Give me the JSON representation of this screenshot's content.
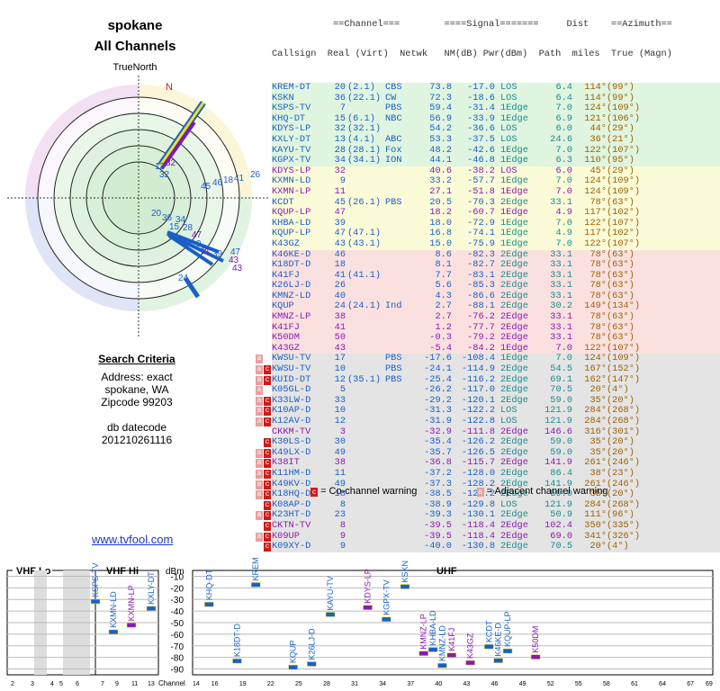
{
  "header": {
    "title": "spokane",
    "subtitle": "All Channels"
  },
  "polar": {
    "north_label": "TrueNorth",
    "n_mark": "N"
  },
  "criteria": {
    "heading": "Search Criteria",
    "address": "Address: exact",
    "city": "spokane, WA",
    "zip": "Zipcode 99203",
    "db": "db datecode",
    "db_value": "201210261116"
  },
  "link": "www.tvfool.com",
  "table": {
    "head1": "           ==Channel===        ====Signal=======     Dist    ==Azimuth==",
    "head2": "Callsign  Real (Virt)  Netwk   NM(dB) Pwr(dBm)  Path  miles  True (Magn)",
    "colors": {
      "green": "#dff5df",
      "yellow": "#fbfbd8",
      "red": "#fbe0e0",
      "gray": "#e4e4e4",
      "blue": "#1a5fc8",
      "purple": "#8a1ab0",
      "teal": "#1a8c8c",
      "olive": "#a06000",
      "darkred": "#c01010"
    },
    "rows": [
      {
        "call": "KREM-DT",
        "real": "20",
        "virt": "(2.1)",
        "net": "CBS",
        "nm": "73.8",
        "pwr": "-17.0",
        "path": "LOS",
        "dist": "6.4",
        "tru": "114°",
        "mag": "(99°)",
        "bg": "green",
        "c": "blue",
        "flag": ""
      },
      {
        "call": "KSKN",
        "real": "36",
        "virt": "(22.1)",
        "net": "CW",
        "nm": "72.3",
        "pwr": "-18.6",
        "path": "LOS",
        "dist": "6.4",
        "tru": "114°",
        "mag": "(99°)",
        "bg": "green",
        "c": "blue",
        "flag": ""
      },
      {
        "call": "KSPS-TV",
        "real": "7",
        "virt": "",
        "net": "PBS",
        "nm": "59.4",
        "pwr": "-31.4",
        "path": "1Edge",
        "dist": "7.0",
        "tru": "124°",
        "mag": "(109°)",
        "bg": "green",
        "c": "blue",
        "flag": ""
      },
      {
        "call": "KHQ-DT",
        "real": "15",
        "virt": "(6.1)",
        "net": "NBC",
        "nm": "56.9",
        "pwr": "-33.9",
        "path": "1Edge",
        "dist": "6.9",
        "tru": "121°",
        "mag": "(106°)",
        "bg": "green",
        "c": "blue",
        "flag": ""
      },
      {
        "call": "KDYS-LP",
        "real": "32",
        "virt": "(32.1)",
        "net": "",
        "nm": "54.2",
        "pwr": "-36.6",
        "path": "LOS",
        "dist": "6.0",
        "tru": "44°",
        "mag": "(29°)",
        "bg": "green",
        "c": "blue",
        "flag": ""
      },
      {
        "call": "KXLY-DT",
        "real": "13",
        "virt": "(4.1)",
        "net": "ABC",
        "nm": "53.3",
        "pwr": "-37.5",
        "path": "LOS",
        "dist": "24.6",
        "tru": "36°",
        "mag": "(21°)",
        "bg": "green",
        "c": "blue",
        "flag": ""
      },
      {
        "call": "KAYU-TV",
        "real": "28",
        "virt": "(28.1)",
        "net": "Fox",
        "nm": "48.2",
        "pwr": "-42.6",
        "path": "1Edge",
        "dist": "7.0",
        "tru": "122°",
        "mag": "(107°)",
        "bg": "green",
        "c": "blue",
        "flag": ""
      },
      {
        "call": "KGPX-TV",
        "real": "34",
        "virt": "(34.1)",
        "net": "ION",
        "nm": "44.1",
        "pwr": "-46.8",
        "path": "1Edge",
        "dist": "6.3",
        "tru": "110°",
        "mag": "(95°)",
        "bg": "green",
        "c": "blue",
        "flag": ""
      },
      {
        "call": "KDYS-LP",
        "real": "32",
        "virt": "",
        "net": "",
        "nm": "40.6",
        "pwr": "-38.2",
        "path": "LOS",
        "dist": "6.0",
        "tru": "45°",
        "mag": "(29°)",
        "bg": "yellow",
        "c": "purple",
        "flag": ""
      },
      {
        "call": "KXMN-LD",
        "real": "9",
        "virt": "",
        "net": "",
        "nm": "33.2",
        "pwr": "-57.7",
        "path": "1Edge",
        "dist": "7.0",
        "tru": "124°",
        "mag": "(109°)",
        "bg": "yellow",
        "c": "blue",
        "flag": ""
      },
      {
        "call": "KXMN-LP",
        "real": "11",
        "virt": "",
        "net": "",
        "nm": "27.1",
        "pwr": "-51.8",
        "path": "1Edge",
        "dist": "7.0",
        "tru": "124°",
        "mag": "(109°)",
        "bg": "yellow",
        "c": "purple",
        "flag": ""
      },
      {
        "call": "KCDT",
        "real": "45",
        "virt": "(26.1)",
        "net": "PBS",
        "nm": "20.5",
        "pwr": "-70.3",
        "path": "2Edge",
        "dist": "33.1",
        "tru": "78°",
        "mag": "(63°)",
        "bg": "yellow",
        "c": "blue",
        "flag": ""
      },
      {
        "call": "KQUP-LP",
        "real": "47",
        "virt": "",
        "net": "",
        "nm": "18.2",
        "pwr": "-60.7",
        "path": "1Edge",
        "dist": "4.9",
        "tru": "117°",
        "mag": "(102°)",
        "bg": "yellow",
        "c": "purple",
        "flag": ""
      },
      {
        "call": "KHBA-LD",
        "real": "39",
        "virt": "",
        "net": "",
        "nm": "18.0",
        "pwr": "-72.9",
        "path": "1Edge",
        "dist": "7.0",
        "tru": "122°",
        "mag": "(107°)",
        "bg": "yellow",
        "c": "blue",
        "flag": ""
      },
      {
        "call": "KQUP-LP",
        "real": "47",
        "virt": "(47.1)",
        "net": "",
        "nm": "16.8",
        "pwr": "-74.1",
        "path": "1Edge",
        "dist": "4.9",
        "tru": "117°",
        "mag": "(102°)",
        "bg": "yellow",
        "c": "blue",
        "flag": ""
      },
      {
        "call": "K43GZ",
        "real": "43",
        "virt": "(43.1)",
        "net": "",
        "nm": "15.0",
        "pwr": "-75.9",
        "path": "1Edge",
        "dist": "7.0",
        "tru": "122°",
        "mag": "(107°)",
        "bg": "yellow",
        "c": "blue",
        "flag": ""
      },
      {
        "call": "K46KE-D",
        "real": "46",
        "virt": "",
        "net": "",
        "nm": "8.6",
        "pwr": "-82.3",
        "path": "2Edge",
        "dist": "33.1",
        "tru": "78°",
        "mag": "(63°)",
        "bg": "red",
        "c": "blue",
        "flag": ""
      },
      {
        "call": "K18DT-D",
        "real": "18",
        "virt": "",
        "net": "",
        "nm": "8.1",
        "pwr": "-82.7",
        "path": "2Edge",
        "dist": "33.1",
        "tru": "78°",
        "mag": "(63°)",
        "bg": "red",
        "c": "blue",
        "flag": ""
      },
      {
        "call": "K41FJ",
        "real": "41",
        "virt": "(41.1)",
        "net": "",
        "nm": "7.7",
        "pwr": "-83.1",
        "path": "2Edge",
        "dist": "33.1",
        "tru": "78°",
        "mag": "(63°)",
        "bg": "red",
        "c": "blue",
        "flag": ""
      },
      {
        "call": "K26LJ-D",
        "real": "26",
        "virt": "",
        "net": "",
        "nm": "5.6",
        "pwr": "-85.3",
        "path": "2Edge",
        "dist": "33.1",
        "tru": "78°",
        "mag": "(63°)",
        "bg": "red",
        "c": "blue",
        "flag": ""
      },
      {
        "call": "KMNZ-LD",
        "real": "40",
        "virt": "",
        "net": "",
        "nm": "4.3",
        "pwr": "-86.6",
        "path": "2Edge",
        "dist": "33.1",
        "tru": "78°",
        "mag": "(63°)",
        "bg": "red",
        "c": "blue",
        "flag": ""
      },
      {
        "call": "KQUP",
        "real": "24",
        "virt": "(24.1)",
        "net": "Ind",
        "nm": "2.7",
        "pwr": "-88.1",
        "path": "2Edge",
        "dist": "30.2",
        "tru": "149°",
        "mag": "(134°)",
        "bg": "red",
        "c": "blue",
        "flag": ""
      },
      {
        "call": "KMNZ-LP",
        "real": "38",
        "virt": "",
        "net": "",
        "nm": "2.7",
        "pwr": "-76.2",
        "path": "2Edge",
        "dist": "33.1",
        "tru": "78°",
        "mag": "(63°)",
        "bg": "red",
        "c": "purple",
        "flag": ""
      },
      {
        "call": "K41FJ",
        "real": "41",
        "virt": "",
        "net": "",
        "nm": "1.2",
        "pwr": "-77.7",
        "path": "2Edge",
        "dist": "33.1",
        "tru": "78°",
        "mag": "(63°)",
        "bg": "red",
        "c": "purple",
        "flag": ""
      },
      {
        "call": "K50DM",
        "real": "50",
        "virt": "",
        "net": "",
        "nm": "-0.3",
        "pwr": "-79.2",
        "path": "2Edge",
        "dist": "33.1",
        "tru": "78°",
        "mag": "(63°)",
        "bg": "red",
        "c": "purple",
        "flag": ""
      },
      {
        "call": "K43GZ",
        "real": "43",
        "virt": "",
        "net": "",
        "nm": "-5.4",
        "pwr": "-84.2",
        "path": "1Edge",
        "dist": "7.0",
        "tru": "122°",
        "mag": "(107°)",
        "bg": "red",
        "c": "purple",
        "flag": ""
      },
      {
        "call": "KWSU-TV",
        "real": "17",
        "virt": "",
        "net": "PBS",
        "nm": "-17.6",
        "pwr": "-108.4",
        "path": "1Edge",
        "dist": "7.0",
        "tru": "124°",
        "mag": "(109°)",
        "bg": "gray",
        "c": "blue",
        "flag": "a"
      },
      {
        "call": "KWSU-TV",
        "real": "10",
        "virt": "",
        "net": "PBS",
        "nm": "-24.1",
        "pwr": "-114.9",
        "path": "2Edge",
        "dist": "54.5",
        "tru": "167°",
        "mag": "(152°)",
        "bg": "gray",
        "c": "blue",
        "flag": "ac"
      },
      {
        "call": "KUID-DT",
        "real": "12",
        "virt": "(35.1)",
        "net": "PBS",
        "nm": "-25.4",
        "pwr": "-116.2",
        "path": "2Edge",
        "dist": "69.1",
        "tru": "162°",
        "mag": "(147°)",
        "bg": "gray",
        "c": "blue",
        "flag": "ac"
      },
      {
        "call": "K05GL-D",
        "real": "5",
        "virt": "",
        "net": "",
        "nm": "-26.2",
        "pwr": "-117.0",
        "path": "2Edge",
        "dist": "70.5",
        "tru": "20°",
        "mag": "(4°)",
        "bg": "gray",
        "c": "blue",
        "flag": "a"
      },
      {
        "call": "K33LW-D",
        "real": "33",
        "virt": "",
        "net": "",
        "nm": "-29.2",
        "pwr": "-120.1",
        "path": "2Edge",
        "dist": "59.0",
        "tru": "35°",
        "mag": "(20°)",
        "bg": "gray",
        "c": "blue",
        "flag": "ac"
      },
      {
        "call": "K10AP-D",
        "real": "10",
        "virt": "",
        "net": "",
        "nm": "-31.3",
        "pwr": "-122.2",
        "path": "LOS",
        "dist": "121.9",
        "tru": "284°",
        "mag": "(268°)",
        "bg": "gray",
        "c": "blue",
        "flag": "ac"
      },
      {
        "call": "K12AV-D",
        "real": "12",
        "virt": "",
        "net": "",
        "nm": "-31.9",
        "pwr": "-122.8",
        "path": "LOS",
        "dist": "121.9",
        "tru": "284°",
        "mag": "(268°)",
        "bg": "gray",
        "c": "blue",
        "flag": "ac"
      },
      {
        "call": "CKKM-TV",
        "real": "3",
        "virt": "",
        "net": "",
        "nm": "-32.9",
        "pwr": "-111.8",
        "path": "2Edge",
        "dist": "146.6",
        "tru": "316°",
        "mag": "(301°)",
        "bg": "gray",
        "c": "purple",
        "flag": ""
      },
      {
        "call": "K30LS-D",
        "real": "30",
        "virt": "",
        "net": "",
        "nm": "-35.4",
        "pwr": "-126.2",
        "path": "2Edge",
        "dist": "59.0",
        "tru": "35°",
        "mag": "(20°)",
        "bg": "gray",
        "c": "blue",
        "flag": "c"
      },
      {
        "call": "K49LX-D",
        "real": "49",
        "virt": "",
        "net": "",
        "nm": "-35.7",
        "pwr": "-126.5",
        "path": "2Edge",
        "dist": "59.0",
        "tru": "35°",
        "mag": "(20°)",
        "bg": "gray",
        "c": "blue",
        "flag": "ac"
      },
      {
        "call": "K38IT",
        "real": "38",
        "virt": "",
        "net": "",
        "nm": "-36.8",
        "pwr": "-115.7",
        "path": "2Edge",
        "dist": "141.9",
        "tru": "261°",
        "mag": "(246°)",
        "bg": "gray",
        "c": "purple",
        "flag": "ac"
      },
      {
        "call": "K11HM-D",
        "real": "11",
        "virt": "",
        "net": "",
        "nm": "-37.2",
        "pwr": "-128.0",
        "path": "2Edge",
        "dist": "86.4",
        "tru": "38°",
        "mag": "(23°)",
        "bg": "gray",
        "c": "blue",
        "flag": "ac"
      },
      {
        "call": "K49KV-D",
        "real": "49",
        "virt": "",
        "net": "",
        "nm": "-37.3",
        "pwr": "-128.2",
        "path": "2Edge",
        "dist": "141.9",
        "tru": "261°",
        "mag": "(246°)",
        "bg": "gray",
        "c": "blue",
        "flag": "ac"
      },
      {
        "call": "K18HQ-D",
        "real": "18",
        "virt": "",
        "net": "",
        "nm": "-38.5",
        "pwr": "-129.2",
        "path": "2Edge",
        "dist": "59.0",
        "tru": "35°",
        "mag": "(20°)",
        "bg": "gray",
        "c": "blue",
        "flag": "ac"
      },
      {
        "call": "K08AP-D",
        "real": "8",
        "virt": "",
        "net": "",
        "nm": "-38.9",
        "pwr": "-129.8",
        "path": "LOS",
        "dist": "121.9",
        "tru": "284°",
        "mag": "(268°)",
        "bg": "gray",
        "c": "blue",
        "flag": "c"
      },
      {
        "call": "K23HT-D",
        "real": "23",
        "virt": "",
        "net": "",
        "nm": "-39.3",
        "pwr": "-130.1",
        "path": "2Edge",
        "dist": "50.9",
        "tru": "111°",
        "mag": "(96°)",
        "bg": "gray",
        "c": "blue",
        "flag": "ac"
      },
      {
        "call": "CKTN-TV",
        "real": "8",
        "virt": "",
        "net": "",
        "nm": "-39.5",
        "pwr": "-118.4",
        "path": "2Edge",
        "dist": "102.4",
        "tru": "350°",
        "mag": "(335°)",
        "bg": "gray",
        "c": "purple",
        "flag": "c"
      },
      {
        "call": "K09UP",
        "real": "9",
        "virt": "",
        "net": "",
        "nm": "-39.5",
        "pwr": "-118.4",
        "path": "2Edge",
        "dist": "69.0",
        "tru": "341°",
        "mag": "(326°)",
        "bg": "gray",
        "c": "purple",
        "flag": "ac"
      },
      {
        "call": "K09XY-D",
        "real": "9",
        "virt": "",
        "net": "",
        "nm": "-40.0",
        "pwr": "-130.8",
        "path": "2Edge",
        "dist": "70.5",
        "tru": "20°",
        "mag": "(4°)",
        "bg": "gray",
        "c": "blue",
        "flag": "c"
      }
    ]
  },
  "legend": {
    "co": "= Co-channel warning",
    "adj": "= Adjacent channel warning"
  },
  "spectrum": {
    "vhflo": "VHF Lo",
    "vhfhi": "VHF Hi",
    "uhf": "UHF",
    "dbm": "dBm",
    "channel": "Channel",
    "y_ticks": [
      "-10",
      "-20",
      "-30",
      "-40",
      "-50",
      "-60",
      "-70",
      "-80",
      "-90"
    ],
    "x_lo": [
      "2",
      "3",
      "4",
      "5",
      "6"
    ],
    "x_hi": [
      "7",
      "9",
      "11",
      "13"
    ],
    "x_uhf": [
      "14",
      "16",
      "19",
      "22",
      "25",
      "28",
      "31",
      "34",
      "37",
      "40",
      "43",
      "46",
      "49",
      "52",
      "55",
      "58",
      "61",
      "64",
      "67",
      "69"
    ],
    "stations": [
      {
        "name": "KSPS-TV",
        "ch": 7,
        "dbm": -31.4,
        "c": "blue"
      },
      {
        "name": "KXMN-LD",
        "ch": 9,
        "dbm": -57.7,
        "c": "blue"
      },
      {
        "name": "KXMN-LP",
        "ch": 11,
        "dbm": -51.8,
        "c": "purple"
      },
      {
        "name": "KXLY-DT",
        "ch": 13,
        "dbm": -37.5,
        "c": "blue"
      },
      {
        "name": "KHQ-DT",
        "ch": 15,
        "dbm": -33.9,
        "c": "blue"
      },
      {
        "name": "K18DT-D",
        "ch": 18,
        "dbm": -82.7,
        "c": "blue"
      },
      {
        "name": "KREM-DT",
        "ch": 20,
        "dbm": -17.0,
        "c": "blue"
      },
      {
        "name": "KQUP",
        "ch": 24,
        "dbm": -88.1,
        "c": "blue"
      },
      {
        "name": "K26LJ-D",
        "ch": 26,
        "dbm": -85.3,
        "c": "blue"
      },
      {
        "name": "KAYU-TV",
        "ch": 28,
        "dbm": -42.6,
        "c": "blue"
      },
      {
        "name": "KDYS-LP",
        "ch": 32,
        "dbm": -36.6,
        "c": "purple"
      },
      {
        "name": "KGPX-TV",
        "ch": 34,
        "dbm": -46.8,
        "c": "blue"
      },
      {
        "name": "KSKN",
        "ch": 36,
        "dbm": -18.6,
        "c": "blue"
      },
      {
        "name": "KMNZ-LP",
        "ch": 38,
        "dbm": -76.2,
        "c": "purple"
      },
      {
        "name": "KHBA-LD",
        "ch": 39,
        "dbm": -72.9,
        "c": "blue"
      },
      {
        "name": "KMNZ-LD",
        "ch": 40,
        "dbm": -86.6,
        "c": "blue"
      },
      {
        "name": "K41FJ",
        "ch": 41,
        "dbm": -77.7,
        "c": "purple"
      },
      {
        "name": "K43GZ",
        "ch": 43,
        "dbm": -84.2,
        "c": "purple"
      },
      {
        "name": "KCDT",
        "ch": 45,
        "dbm": -70.3,
        "c": "blue"
      },
      {
        "name": "K46KE-D",
        "ch": 46,
        "dbm": -82.3,
        "c": "blue"
      },
      {
        "name": "KQUP-LP",
        "ch": 47,
        "dbm": -74.1,
        "c": "blue"
      },
      {
        "name": "K50DM",
        "ch": 50,
        "dbm": -79.2,
        "c": "purple"
      }
    ]
  }
}
